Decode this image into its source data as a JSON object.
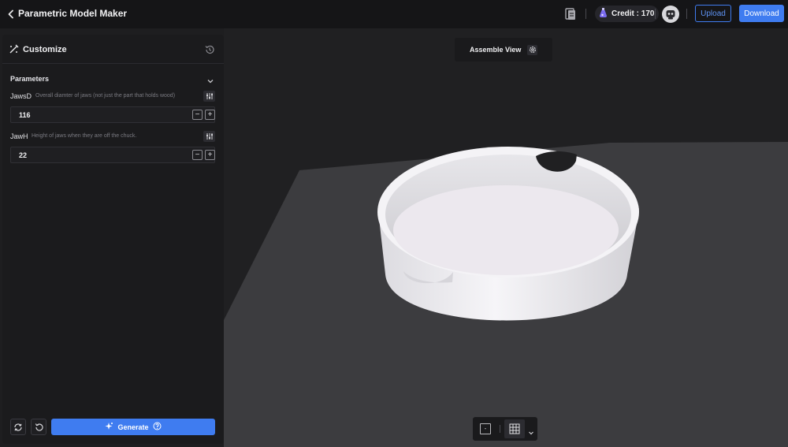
{
  "header": {
    "title": "Parametric Model Maker",
    "credit_label": "Credit : 170",
    "upload_label": "Upload",
    "download_label": "Download",
    "icons": [
      "chevron-left-icon",
      "document-icon",
      "potion-icon",
      "avatar-icon"
    ]
  },
  "panel": {
    "title": "Customize",
    "section_title": "Parameters",
    "parameters": [
      {
        "name": "JawsD",
        "description": "Overall diamter of jaws (not just the part that holds wood)",
        "value": "116"
      },
      {
        "name": "JawH",
        "description": "Height of jaws when they are off the chuck.",
        "value": "22"
      }
    ],
    "generate_label": "Generate",
    "step_minus": "−",
    "step_plus": "+"
  },
  "viewport": {
    "assemble_label": "Assemble View",
    "frame_glyph": "-"
  },
  "colors": {
    "accent": "#3f7cf0",
    "background": "#1e1e20",
    "model": "#ecebef"
  }
}
